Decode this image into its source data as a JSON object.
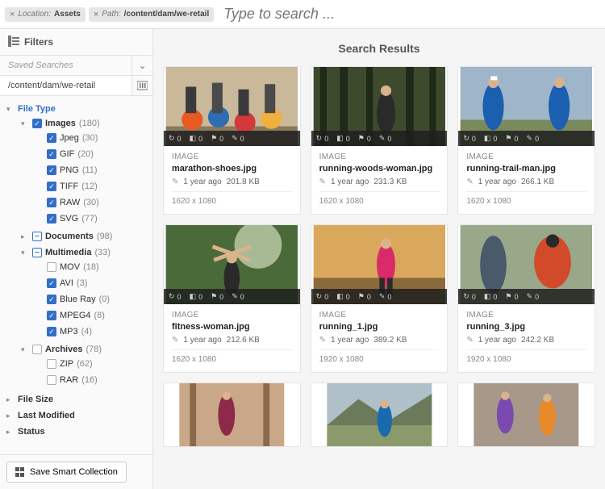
{
  "search": {
    "chips": [
      {
        "label": "Location:",
        "value": "Assets"
      },
      {
        "label": "Path:",
        "value": "/content/dam/we-retail"
      }
    ],
    "placeholder": "Type to search ..."
  },
  "sidebar": {
    "filters_label": "Filters",
    "saved_searches_label": "Saved Searches",
    "path_value": "/content/dam/we-retail",
    "save_collection_label": "Save Smart Collection",
    "sections": {
      "file_type": {
        "label": "File Type",
        "groups": [
          {
            "id": "images",
            "label": "Images",
            "count": "(180)",
            "state": "checked",
            "expanded": true,
            "children": [
              {
                "label": "Jpeg",
                "count": "(30)",
                "state": "checked"
              },
              {
                "label": "GIF",
                "count": "(20)",
                "state": "checked"
              },
              {
                "label": "PNG",
                "count": "(11)",
                "state": "checked"
              },
              {
                "label": "TIFF",
                "count": "(12)",
                "state": "checked"
              },
              {
                "label": "RAW",
                "count": "(30)",
                "state": "checked"
              },
              {
                "label": "SVG",
                "count": "(77)",
                "state": "checked"
              }
            ]
          },
          {
            "id": "documents",
            "label": "Documents",
            "count": "(98)",
            "state": "mixed",
            "expanded": false
          },
          {
            "id": "multimedia",
            "label": "Multimedia",
            "count": "(33)",
            "state": "mixed",
            "expanded": true,
            "children": [
              {
                "label": "MOV",
                "count": "(18)",
                "state": ""
              },
              {
                "label": "AVI",
                "count": "(3)",
                "state": "checked"
              },
              {
                "label": "Blue Ray",
                "count": "(0)",
                "state": "checked"
              },
              {
                "label": "MPEG4",
                "count": "(8)",
                "state": "checked"
              },
              {
                "label": "MP3",
                "count": "(4)",
                "state": "checked"
              }
            ]
          },
          {
            "id": "archives",
            "label": "Archives",
            "count": "(78)",
            "state": "",
            "expanded": true,
            "children": [
              {
                "label": "ZIP",
                "count": "(62)",
                "state": ""
              },
              {
                "label": "RAR",
                "count": "(16)",
                "state": ""
              }
            ]
          }
        ]
      },
      "file_size": {
        "label": "File Size"
      },
      "last_modified": {
        "label": "Last Modified"
      },
      "status": {
        "label": "Status"
      }
    }
  },
  "results": {
    "title": "Search Results",
    "overlay_zero": "0",
    "cards": [
      {
        "type": "IMAGE",
        "name": "marathon-shoes.jpg",
        "age": "1 year ago",
        "size": "201.8 KB",
        "dim": "1620 x 1080",
        "thumb": "marathon"
      },
      {
        "type": "IMAGE",
        "name": "running-woods-woman.jpg",
        "age": "1 year ago",
        "size": "231.3 KB",
        "dim": "1620 x 1080",
        "thumb": "woods-woman"
      },
      {
        "type": "IMAGE",
        "name": "running-trail-man.jpg",
        "age": "1 year ago",
        "size": "266.1 KB",
        "dim": "1620 x 1080",
        "thumb": "trail-man"
      },
      {
        "type": "IMAGE",
        "name": "fitness-woman.jpg",
        "age": "1 year ago",
        "size": "212.6 KB",
        "dim": "1620 x 1080",
        "thumb": "fitness"
      },
      {
        "type": "IMAGE",
        "name": "running_1.jpg",
        "age": "1 year ago",
        "size": "389.2 KB",
        "dim": "1920 x 1080",
        "thumb": "run1"
      },
      {
        "type": "IMAGE",
        "name": "running_3.jpg",
        "age": "1 year ago",
        "size": "242.2 KB",
        "dim": "1920 x 1080",
        "thumb": "run3"
      },
      {
        "type": "IMAGE",
        "name": "",
        "age": "",
        "size": "",
        "dim": "",
        "thumb": "partial1",
        "partial": true
      },
      {
        "type": "IMAGE",
        "name": "",
        "age": "",
        "size": "",
        "dim": "",
        "thumb": "partial2",
        "partial": true
      },
      {
        "type": "IMAGE",
        "name": "",
        "age": "",
        "size": "",
        "dim": "",
        "thumb": "partial3",
        "partial": true
      }
    ]
  }
}
